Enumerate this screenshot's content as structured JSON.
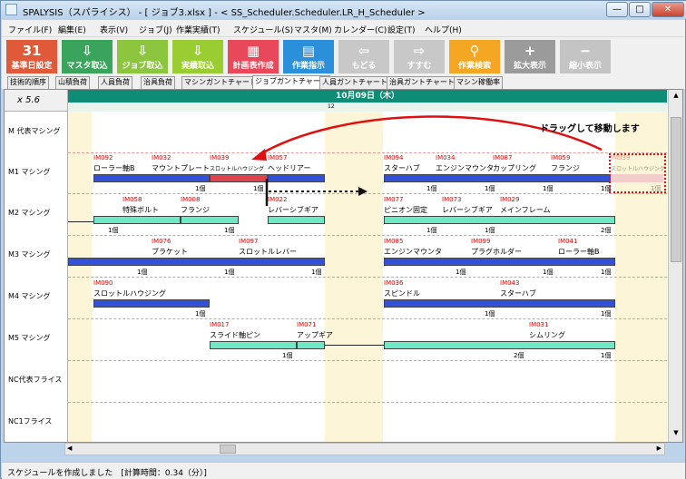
{
  "window": {
    "title": "SPALYSIS（スパライシス） - [ ジョブ3.xlsx ] - < SS_Scheduler.Scheduler.LR_H_Scheduler >",
    "minimize": "—",
    "maximize": "□",
    "close": "✕"
  },
  "menu": [
    "ファイル(F)",
    "編集(E)",
    "表示(V)",
    "ジョブ(J)",
    "作業実績(T)",
    "スケジュール(S)",
    "マスタ(M)",
    "カレンダー(C)",
    "設定(T)",
    "ヘルプ(H)"
  ],
  "toolbar": [
    {
      "label": "基準日設定",
      "color": "#e05a3a",
      "icon": "31"
    },
    {
      "label": "マスタ取込",
      "color": "#3aa45c",
      "icon": "⇩"
    },
    {
      "label": "ジョブ取込",
      "color": "#8cc63f",
      "icon": "⇩"
    },
    {
      "label": "実績取込",
      "color": "#9acd32",
      "icon": "⇩"
    },
    {
      "label": "計画表作成",
      "color": "#e8485a",
      "icon": "▦"
    },
    {
      "label": "作業指示",
      "color": "#2b8fd9",
      "icon": "▤"
    },
    {
      "label": "もどる",
      "color": "#c8c8c8",
      "icon": "⇦"
    },
    {
      "label": "すすむ",
      "color": "#c8c8c8",
      "icon": "⇨"
    },
    {
      "label": "作業検索",
      "color": "#f5a623",
      "icon": "⚲"
    },
    {
      "label": "拡大表示",
      "color": "#9b9b9b",
      "icon": "+"
    },
    {
      "label": "縮小表示",
      "color": "#c4c4c4",
      "icon": "−"
    }
  ],
  "tabs": [
    "技術的順序",
    "山積負荷",
    "人員負荷",
    "治具負荷",
    "マシンガントチャート",
    "ジョブガントチャート",
    "人員ガントチャート",
    "治具ガントチャート",
    "マシン稼働率"
  ],
  "active_tab": 5,
  "gantt": {
    "zoom": "x 5.6",
    "date": "10月09日（木）",
    "hour_marker": "12",
    "rows": [
      "M 代表マシング",
      "M1 マシング",
      "M2 マシング",
      "M3 マシング",
      "M4 マシング",
      "M5 マシング",
      "NC代表フライス",
      "NC1フライス"
    ],
    "annotation": "ドラッグして移動します",
    "jobs": [
      {
        "code": "IM092",
        "name": "ローラー軸B"
      },
      {
        "code": "IM032",
        "name": "マウントプレート"
      },
      {
        "code": "IM039",
        "name": "スロットルハウジング"
      },
      {
        "code": "IM057",
        "name": "ヘッドリアー"
      },
      {
        "code": "IM094",
        "name": "スターハブ"
      },
      {
        "code": "IM034",
        "name": "エンジンマウンタ"
      },
      {
        "code": "IM087",
        "name": "カップリング"
      },
      {
        "code": "IM059",
        "name": "フランジ"
      },
      {
        "code": "IM039",
        "name": "スロットルハウジング"
      },
      {
        "code": "IM058",
        "name": "特殊ボルト"
      },
      {
        "code": "IM008",
        "name": "フランジ"
      },
      {
        "code": "IM022",
        "name": "レバーシブギア"
      },
      {
        "code": "IM077",
        "name": "ピニオン固定"
      },
      {
        "code": "IM073",
        "name": "レバーシブギア"
      },
      {
        "code": "IM029",
        "name": "メインフレーム"
      },
      {
        "code": "IM076",
        "name": "ブラケット"
      },
      {
        "code": "IM097",
        "name": "スロットルレバー"
      },
      {
        "code": "IM085",
        "name": "エンジンマウンタ"
      },
      {
        "code": "IM099",
        "name": "プラグホルダー"
      },
      {
        "code": "IM041",
        "name": "ローラー軸B"
      },
      {
        "code": "IM090",
        "name": "スロットルハウジング"
      },
      {
        "code": "IM036",
        "name": "スピンドル"
      },
      {
        "code": "IM043",
        "name": "スターハブ"
      },
      {
        "code": "IM017",
        "name": "スライド軸ピン"
      },
      {
        "code": "IM071",
        "name": "アップギア"
      },
      {
        "code": "IM031",
        "name": "シムリング"
      }
    ],
    "qty": {
      "one": "1個",
      "two": "2個"
    }
  },
  "status": "スケジュールを作成しました　[計算時間：0.34（分）]"
}
